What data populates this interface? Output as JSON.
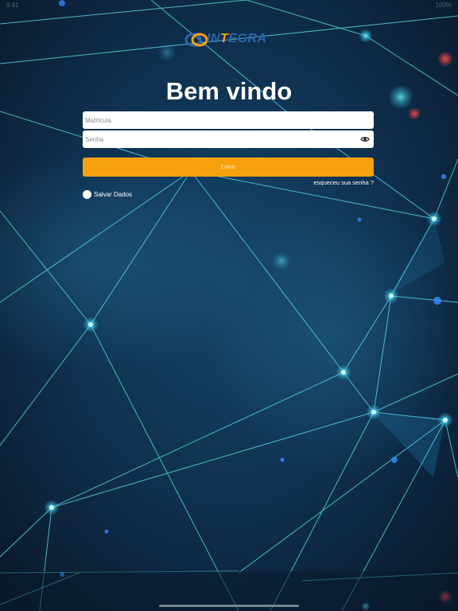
{
  "status_bar": {
    "time": "9:41",
    "battery": "100%"
  },
  "logo": {
    "part_blue_1": "IN",
    "part_yellow": "T",
    "part_blue_2": "EGRA"
  },
  "title": "Bem vindo",
  "form": {
    "matricula_placeholder": "Matrícula",
    "senha_placeholder": "Senha",
    "submit_label": "Entrar",
    "forgot_label": "esqueceu sua senha ?",
    "save_label": "Salvar Dados"
  },
  "colors": {
    "background": "#0d2438",
    "accent": "#f7a10f",
    "network_line": "#5fe3f2",
    "logo_blue": "#2e64a8",
    "logo_yellow": "#f2a516"
  }
}
